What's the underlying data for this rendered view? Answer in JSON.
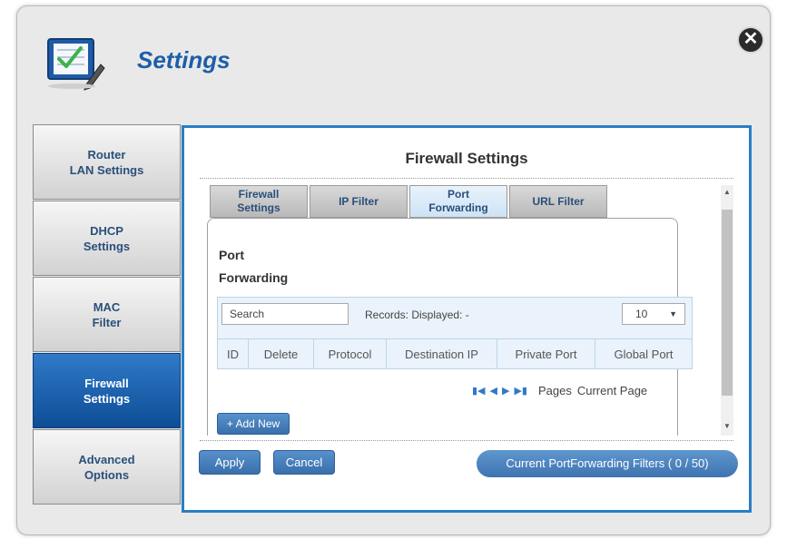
{
  "header": {
    "title": "Settings",
    "icon": "settings-checklist-icon",
    "close_icon": "close-icon"
  },
  "sidebar": {
    "items": [
      {
        "label": "Router\nLAN Settings",
        "active": false
      },
      {
        "label": "DHCP\nSettings",
        "active": false
      },
      {
        "label": "MAC\nFilter",
        "active": false
      },
      {
        "label": "Firewall\nSettings",
        "active": true
      },
      {
        "label": "Advanced\nOptions",
        "active": false
      }
    ]
  },
  "main": {
    "title": "Firewall Settings",
    "tabs": [
      {
        "label": "Firewall\nSettings",
        "active": false
      },
      {
        "label": "IP Filter",
        "active": false
      },
      {
        "label": "Port\nForwarding",
        "active": true
      },
      {
        "label": "URL Filter",
        "active": false
      }
    ],
    "panel_title": "Port\nForwarding",
    "search": {
      "placeholder": "Search"
    },
    "records_label": "Records:  Displayed: -",
    "page_size": "10",
    "columns": [
      "ID",
      "Delete",
      "Protocol",
      "Destination IP",
      "Private Port",
      "Global Port"
    ],
    "pager": {
      "icons": [
        "first-page-icon",
        "prev-page-icon",
        "next-page-icon",
        "last-page-icon"
      ],
      "pages_label": "Pages",
      "current_label": "Current Page"
    },
    "add_new_label": "+ Add New"
  },
  "footer": {
    "apply_label": "Apply",
    "cancel_label": "Cancel",
    "counter_label": "Current PortForwarding Filters ( 0 / 50)"
  },
  "colors": {
    "accent": "#2a7ec4",
    "active_nav": "#1a5ea8",
    "button": "#4a81bd"
  }
}
